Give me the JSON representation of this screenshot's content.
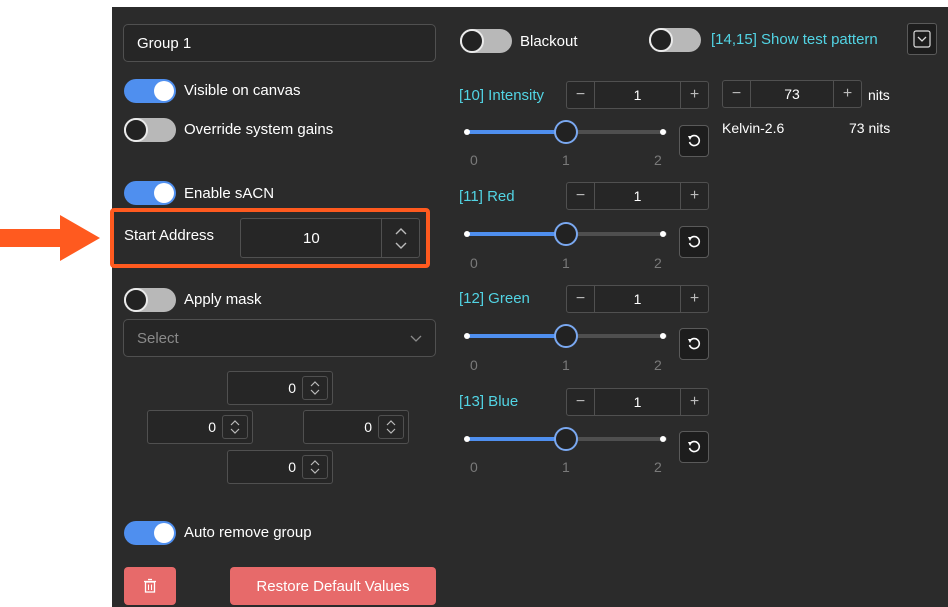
{
  "group_name": "Group 1",
  "toggles": {
    "visible_on_canvas": {
      "label": "Visible on canvas",
      "on": true
    },
    "override_system_gains": {
      "label": "Override system gains",
      "on": false
    },
    "enable_sacn": {
      "label": "Enable sACN",
      "on": true
    },
    "apply_mask": {
      "label": "Apply mask",
      "on": false
    },
    "auto_remove_group": {
      "label": "Auto remove group",
      "on": true
    },
    "blackout": {
      "label": "Blackout",
      "on": false
    },
    "show_test_pattern": {
      "label": "[14,15] Show test pattern",
      "on": false
    }
  },
  "start_address": {
    "label": "Start Address",
    "value": "10"
  },
  "mask_select": {
    "placeholder": "Select"
  },
  "mask_offsets": {
    "top": "0",
    "left": "0",
    "right": "0",
    "bottom": "0"
  },
  "buttons": {
    "restore": "Restore Default Values"
  },
  "channels": [
    {
      "label": "[10] Intensity",
      "value": "1",
      "slider_value": 1,
      "min": 0,
      "max": 2
    },
    {
      "label": "[11] Red",
      "value": "1",
      "slider_value": 1,
      "min": 0,
      "max": 2
    },
    {
      "label": "[12] Green",
      "value": "1",
      "slider_value": 1,
      "min": 0,
      "max": 2
    },
    {
      "label": "[13] Blue",
      "value": "1",
      "slider_value": 1,
      "min": 0,
      "max": 2
    }
  ],
  "ticks": [
    "0",
    "1",
    "2"
  ],
  "nits": {
    "value": "73",
    "unit": "nits",
    "kelvin_label": "Kelvin-2.6",
    "kelvin_value": "73 nits"
  },
  "colors": {
    "accent": "#4f8fef",
    "highlight": "#ff5a1f",
    "label_cyan": "#52d4e4",
    "danger": "#e76a6a"
  }
}
